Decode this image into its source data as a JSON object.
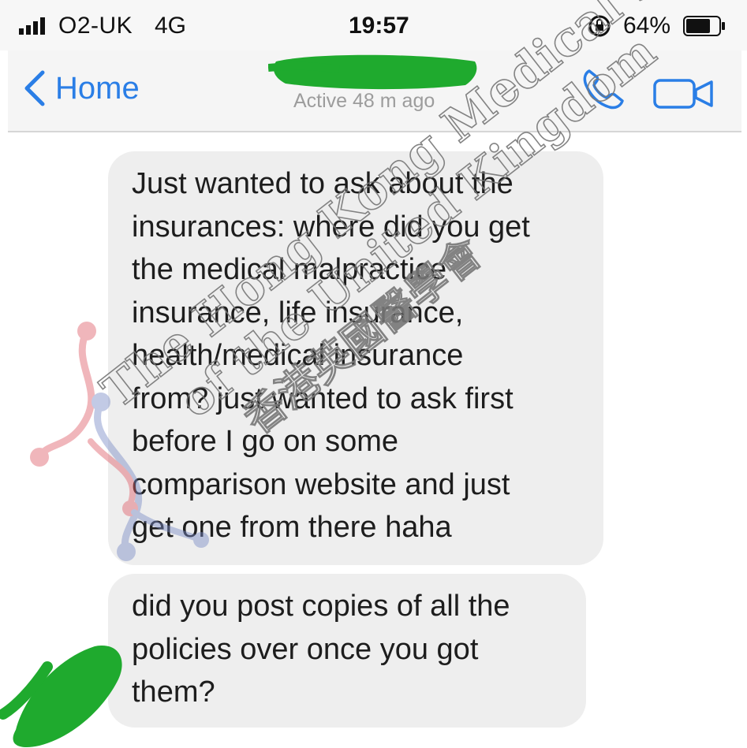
{
  "status_bar": {
    "carrier": "O2-UK",
    "network": "4G",
    "time": "19:57",
    "battery_percent": "64%",
    "icons": [
      "signal-icon",
      "rotation-lock-icon",
      "battery-icon"
    ]
  },
  "nav": {
    "back_label": "Home",
    "contact_status": "Active 48 m ago",
    "icons": [
      "back-chevron-icon",
      "phone-icon",
      "video-camera-icon"
    ],
    "accent_color": "#2a7ee6"
  },
  "messages": [
    {
      "lines": [
        "Just wanted to ask about the",
        "insurances: where did you get",
        "the medical malpractice",
        "insurance, life insurance,",
        "health/medical insurance",
        "from? just wanted to ask first",
        "before I go on some",
        "comparison website and just",
        "get one from there haha"
      ]
    },
    {
      "lines": [
        "did you post copies of all the",
        "policies over once you got",
        "them?"
      ]
    }
  ],
  "watermark": {
    "line1": "The Hong Kong Medical Society",
    "line2": "of the United Kingdom",
    "line3": "香港英國醫學會"
  },
  "colors": {
    "bubble": "#eeeeee",
    "redaction": "#1faa2e"
  }
}
